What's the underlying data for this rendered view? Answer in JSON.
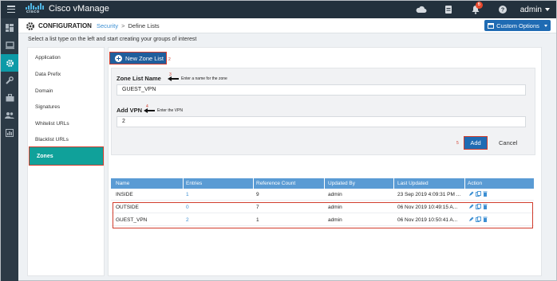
{
  "app": {
    "brand": "cisco",
    "title": "Cisco vManage"
  },
  "topbar": {
    "notification_count": "6",
    "user": "admin"
  },
  "rail": {
    "icons": [
      "dashboard-icon",
      "monitor-icon",
      "configuration-icon",
      "tools-icon",
      "maintenance-icon",
      "admin-icon",
      "analytics-icon"
    ],
    "active": "configuration-icon"
  },
  "header": {
    "title": "CONFIGURATION",
    "breadcrumb_link": "Security",
    "breadcrumb_sep": ">",
    "breadcrumb_current": "Define Lists",
    "custom_options": "Custom Options"
  },
  "instruction": "Select a list type on the left and start creating your groups of interest",
  "list_types": [
    "Application",
    "Data Prefix",
    "Domain",
    "Signatures",
    "Whitelist URLs",
    "Blacklist URLs",
    "Zones"
  ],
  "selected_list_type": "Zones",
  "new_zone_button": "New Zone List",
  "steps": {
    "one": "2",
    "two": "3",
    "three": "4",
    "four": "5"
  },
  "form": {
    "zone_list_label": "Zone List Name",
    "zone_list_hint": "Enter a name for the  zone",
    "zone_list_value": "GUEST_VPN",
    "add_vpn_label": "Add VPN",
    "add_vpn_hint": "Enter the VPN",
    "add_vpn_value": "2",
    "add_button": "Add",
    "cancel_button": "Cancel"
  },
  "table": {
    "columns": [
      "Name",
      "Entries",
      "Reference Count",
      "Updated By",
      "Last Updated",
      "Action"
    ],
    "rows": [
      {
        "name": "INSIDE",
        "entries": "1",
        "reference_count": "9",
        "updated_by": "admin",
        "last_updated": "23 Sep 2019 4:09:31 PM ..."
      },
      {
        "name": "OUTSIDE",
        "entries": "0",
        "reference_count": "7",
        "updated_by": "admin",
        "last_updated": "06 Nov 2019 10:49:15 A..."
      },
      {
        "name": "GUEST_VPN",
        "entries": "2",
        "reference_count": "1",
        "updated_by": "admin",
        "last_updated": "06 Nov 2019 10:50:41 A..."
      }
    ]
  },
  "colors": {
    "topbar": "#23313d",
    "accent_teal": "#10a19a",
    "primary_blue": "#1f6bb3",
    "highlight_red": "#d13c2c",
    "table_header": "#5a9bd4"
  }
}
